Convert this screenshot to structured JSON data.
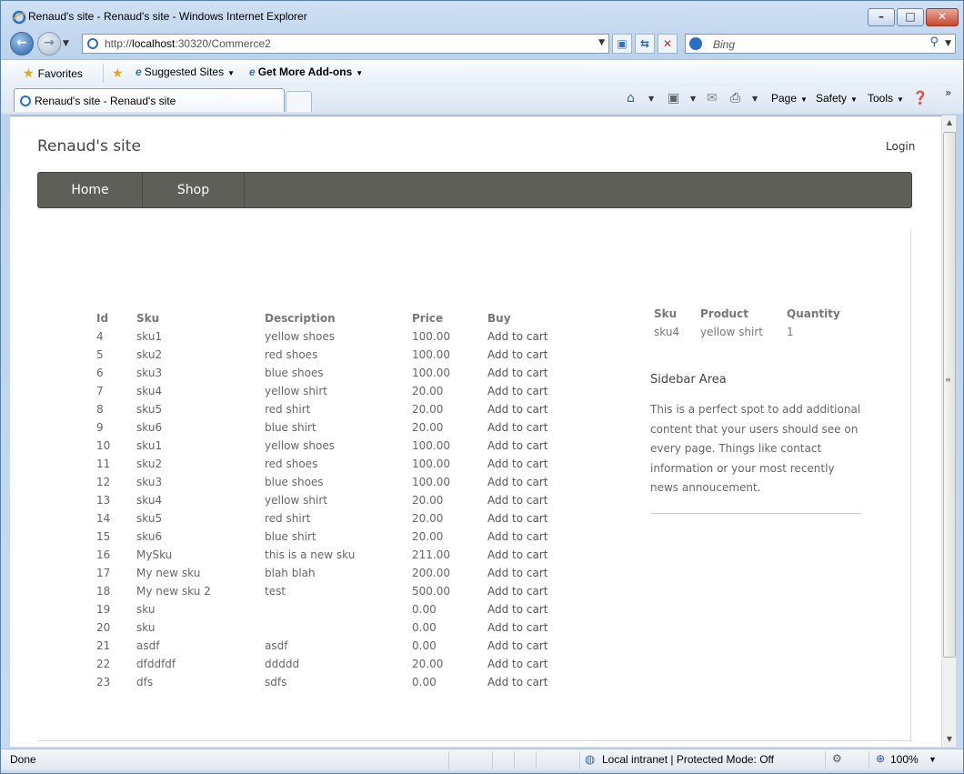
{
  "window": {
    "title": "Renaud's site - Renaud's site - Windows Internet Explorer",
    "min_glyph": "–",
    "max_glyph": "□",
    "close_glyph": "✕"
  },
  "address": {
    "url_prefix": "http://",
    "url_host": "localhost",
    "url_rest": ":30320/Commerce2",
    "search_placeholder": "Bing"
  },
  "favorites_bar": {
    "favorites_label": "Favorites",
    "suggested_label": "Suggested Sites",
    "addons_label": "Get More Add-ons"
  },
  "tabs": [
    {
      "label": "Renaud's site - Renaud's site"
    }
  ],
  "command_bar": {
    "page_label": "Page",
    "safety_label": "Safety",
    "tools_label": "Tools"
  },
  "site": {
    "title": "Renaud's site",
    "login_label": "Login",
    "menu": [
      {
        "label": "Home"
      },
      {
        "label": "Shop"
      }
    ]
  },
  "products_table": {
    "headers": [
      "Id",
      "Sku",
      "Description",
      "Price",
      "Buy"
    ],
    "rows": [
      {
        "id": "4",
        "sku": "sku1",
        "description": "yellow shoes",
        "price": "100.00",
        "buy": "Add to cart"
      },
      {
        "id": "5",
        "sku": "sku2",
        "description": "red shoes",
        "price": "100.00",
        "buy": "Add to cart"
      },
      {
        "id": "6",
        "sku": "sku3",
        "description": "blue shoes",
        "price": "100.00",
        "buy": "Add to cart"
      },
      {
        "id": "7",
        "sku": "sku4",
        "description": "yellow shirt",
        "price": "20.00",
        "buy": "Add to cart"
      },
      {
        "id": "8",
        "sku": "sku5",
        "description": "red shirt",
        "price": "20.00",
        "buy": "Add to cart"
      },
      {
        "id": "9",
        "sku": "sku6",
        "description": "blue shirt",
        "price": "20.00",
        "buy": "Add to cart"
      },
      {
        "id": "10",
        "sku": "sku1",
        "description": "yellow shoes",
        "price": "100.00",
        "buy": "Add to cart"
      },
      {
        "id": "11",
        "sku": "sku2",
        "description": "red shoes",
        "price": "100.00",
        "buy": "Add to cart"
      },
      {
        "id": "12",
        "sku": "sku3",
        "description": "blue shoes",
        "price": "100.00",
        "buy": "Add to cart"
      },
      {
        "id": "13",
        "sku": "sku4",
        "description": "yellow shirt",
        "price": "20.00",
        "buy": "Add to cart"
      },
      {
        "id": "14",
        "sku": "sku5",
        "description": "red shirt",
        "price": "20.00",
        "buy": "Add to cart"
      },
      {
        "id": "15",
        "sku": "sku6",
        "description": "blue shirt",
        "price": "20.00",
        "buy": "Add to cart"
      },
      {
        "id": "16",
        "sku": "MySku",
        "description": "this is a new sku",
        "price": "211.00",
        "buy": "Add to cart"
      },
      {
        "id": "17",
        "sku": "My new sku",
        "description": "blah blah",
        "price": "200.00",
        "buy": "Add to cart"
      },
      {
        "id": "18",
        "sku": "My new sku 2",
        "description": "test",
        "price": "500.00",
        "buy": "Add to cart"
      },
      {
        "id": "19",
        "sku": "sku",
        "description": "",
        "price": "0.00",
        "buy": "Add to cart"
      },
      {
        "id": "20",
        "sku": "sku",
        "description": "",
        "price": "0.00",
        "buy": "Add to cart"
      },
      {
        "id": "21",
        "sku": "asdf",
        "description": "asdf",
        "price": "0.00",
        "buy": "Add to cart"
      },
      {
        "id": "22",
        "sku": "dfddfdf",
        "description": "ddddd",
        "price": "20.00",
        "buy": "Add to cart"
      },
      {
        "id": "23",
        "sku": "dfs",
        "description": "sdfs",
        "price": "0.00",
        "buy": "Add to cart"
      }
    ]
  },
  "cart_table": {
    "headers": [
      "Sku",
      "Product",
      "Quantity"
    ],
    "rows": [
      {
        "sku": "sku4",
        "product": "yellow shirt",
        "quantity": "1"
      }
    ]
  },
  "sidebar": {
    "title": "Sidebar Area",
    "text": "This is a perfect spot to add additional content that your users should see on every page. Things like contact information or your most recently news annoucement."
  },
  "status_bar": {
    "status": "Done",
    "zone": "Local intranet | Protected Mode: Off",
    "zoom": "100%"
  },
  "colors": {
    "menubar": "#5f5f5a",
    "text": "#666666",
    "chrome": "#c7dbf1"
  }
}
